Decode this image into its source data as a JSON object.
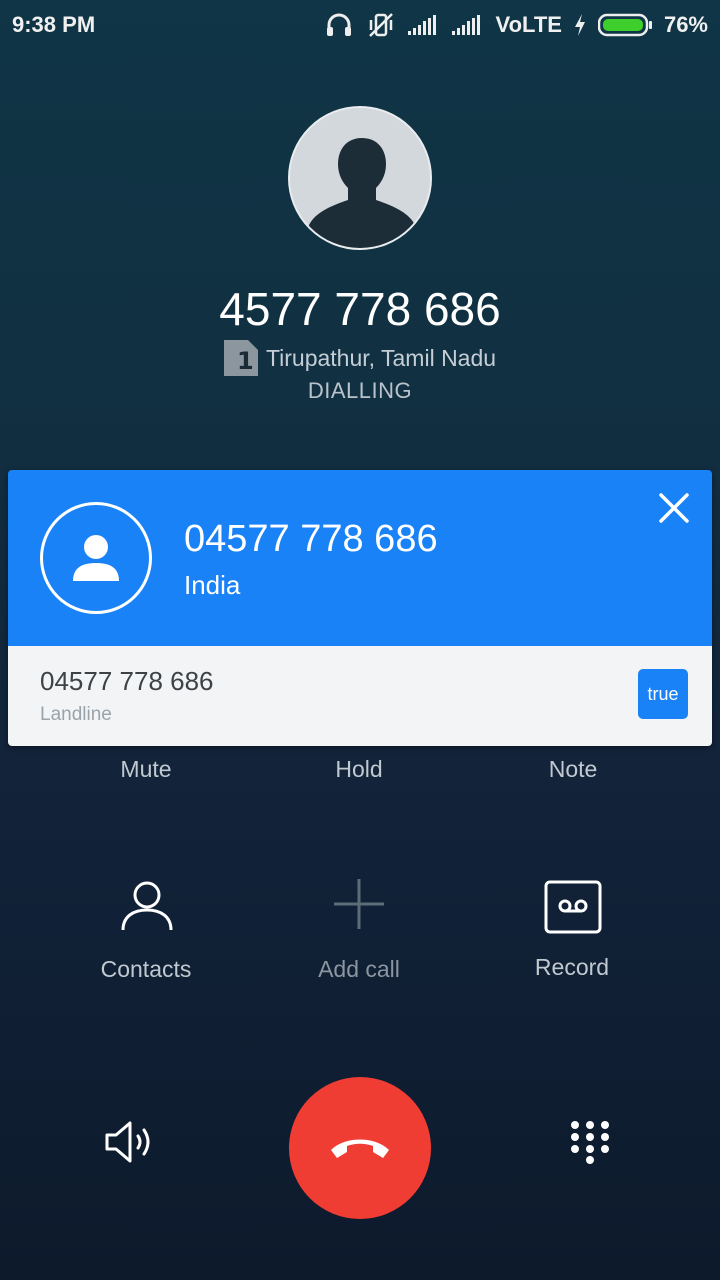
{
  "status_bar": {
    "time": "9:38 PM",
    "network": "VoLTE",
    "battery": "76%",
    "battery_level": 0.76,
    "icons": [
      "headphones-icon",
      "vibrate-off-icon",
      "signal-icon",
      "signal-icon",
      "charging-icon",
      "battery-icon"
    ]
  },
  "caller": {
    "number": "4577 778 686",
    "sim_slot": "1",
    "location": "Tirupathur, Tamil Nadu",
    "status": "DIALLING"
  },
  "truecaller": {
    "number": "04577 778 686",
    "country": "India",
    "detail_number": "04577 778 686",
    "line_type": "Landline",
    "badge": "true",
    "brand_color": "#1a82f7"
  },
  "controls": {
    "mute": "Mute",
    "hold": "Hold",
    "note": "Note",
    "contacts": "Contacts",
    "add_call": "Add call",
    "record": "Record"
  },
  "actions": {
    "end_call_color": "#f03d33"
  }
}
